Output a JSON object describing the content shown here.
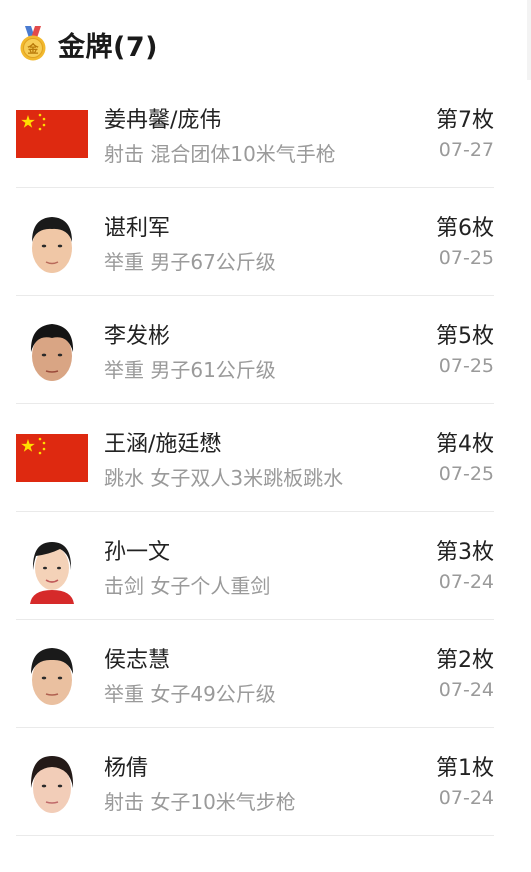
{
  "header": {
    "medal_icon": "gold-medal-icon",
    "medal_char": "金",
    "title": "金牌(7)"
  },
  "colors": {
    "flag_red": "#DE2910",
    "flag_yellow": "#FFDE00",
    "medal_gold": "#F2B92E",
    "secondary_text": "#9A9A9A"
  },
  "medals": [
    {
      "name": "姜冉馨/庞伟",
      "sport": "射击",
      "event": "混合团体10米气手枪",
      "rank": "第7枚",
      "date": "07-27",
      "avatar": "china-flag-icon"
    },
    {
      "name": "谌利军",
      "sport": "举重",
      "event": "男子67公斤级",
      "rank": "第6枚",
      "date": "07-25",
      "avatar": "athlete-photo"
    },
    {
      "name": "李发彬",
      "sport": "举重",
      "event": "男子61公斤级",
      "rank": "第5枚",
      "date": "07-25",
      "avatar": "athlete-photo"
    },
    {
      "name": "王涵/施廷懋",
      "sport": "跳水",
      "event": "女子双人3米跳板跳水",
      "rank": "第4枚",
      "date": "07-25",
      "avatar": "china-flag-icon"
    },
    {
      "name": "孙一文",
      "sport": "击剑",
      "event": "女子个人重剑",
      "rank": "第3枚",
      "date": "07-24",
      "avatar": "athlete-photo"
    },
    {
      "name": "侯志慧",
      "sport": "举重",
      "event": "女子49公斤级",
      "rank": "第2枚",
      "date": "07-24",
      "avatar": "athlete-photo"
    },
    {
      "name": "杨倩",
      "sport": "射击",
      "event": "女子10米气步枪",
      "rank": "第1枚",
      "date": "07-24",
      "avatar": "athlete-photo"
    }
  ]
}
